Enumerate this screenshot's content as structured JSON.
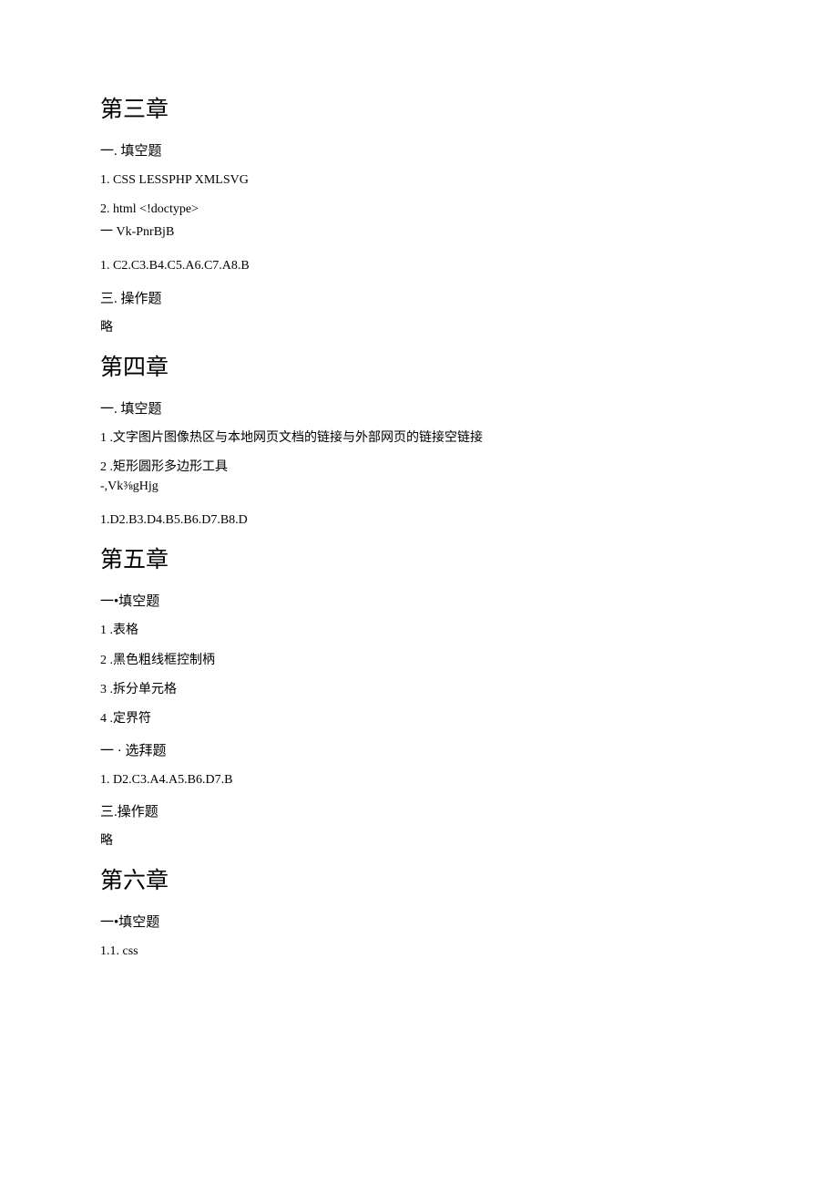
{
  "ch3": {
    "title": "第三章",
    "sec1_heading": "一. 填空题",
    "q1": "1.   CSS    LESSPHP          XMLSVG",
    "q2": "2.   html   <!doctype>",
    "garbled": "一 Vk-PnrBjB",
    "mc": "1.   C2.C3.B4.C5.A6.C7.A8.B",
    "sec3_heading": "三. 操作题",
    "omit": "略"
  },
  "ch4": {
    "title": "第四章",
    "sec1_heading": "一. 填空题",
    "q1": "1   .文字图片图像热区与本地网页文档的链接与外部网页的链接空链接",
    "q2": "2   .矩形圆形多边形工具",
    "garbled": "-,Vk⅜gHjg",
    "mc": "1.D2.B3.D4.B5.B6.D7.B8.D"
  },
  "ch5": {
    "title": "第五章",
    "sec1_heading": "一•填空题",
    "q1": "1   .表格",
    "q2": "2   .黑色粗线框控制柄",
    "q3": "3   .拆分单元格",
    "q4": "4   .定界符",
    "sec2_heading": "一 · 选拜题",
    "mc": "1.    D2.C3.A4.A5.B6.D7.B",
    "sec3_heading": "三.操作题",
    "omit": "略"
  },
  "ch6": {
    "title": "第六章",
    "sec1_heading": "一•填空题",
    "q1": "1.1.   css"
  }
}
